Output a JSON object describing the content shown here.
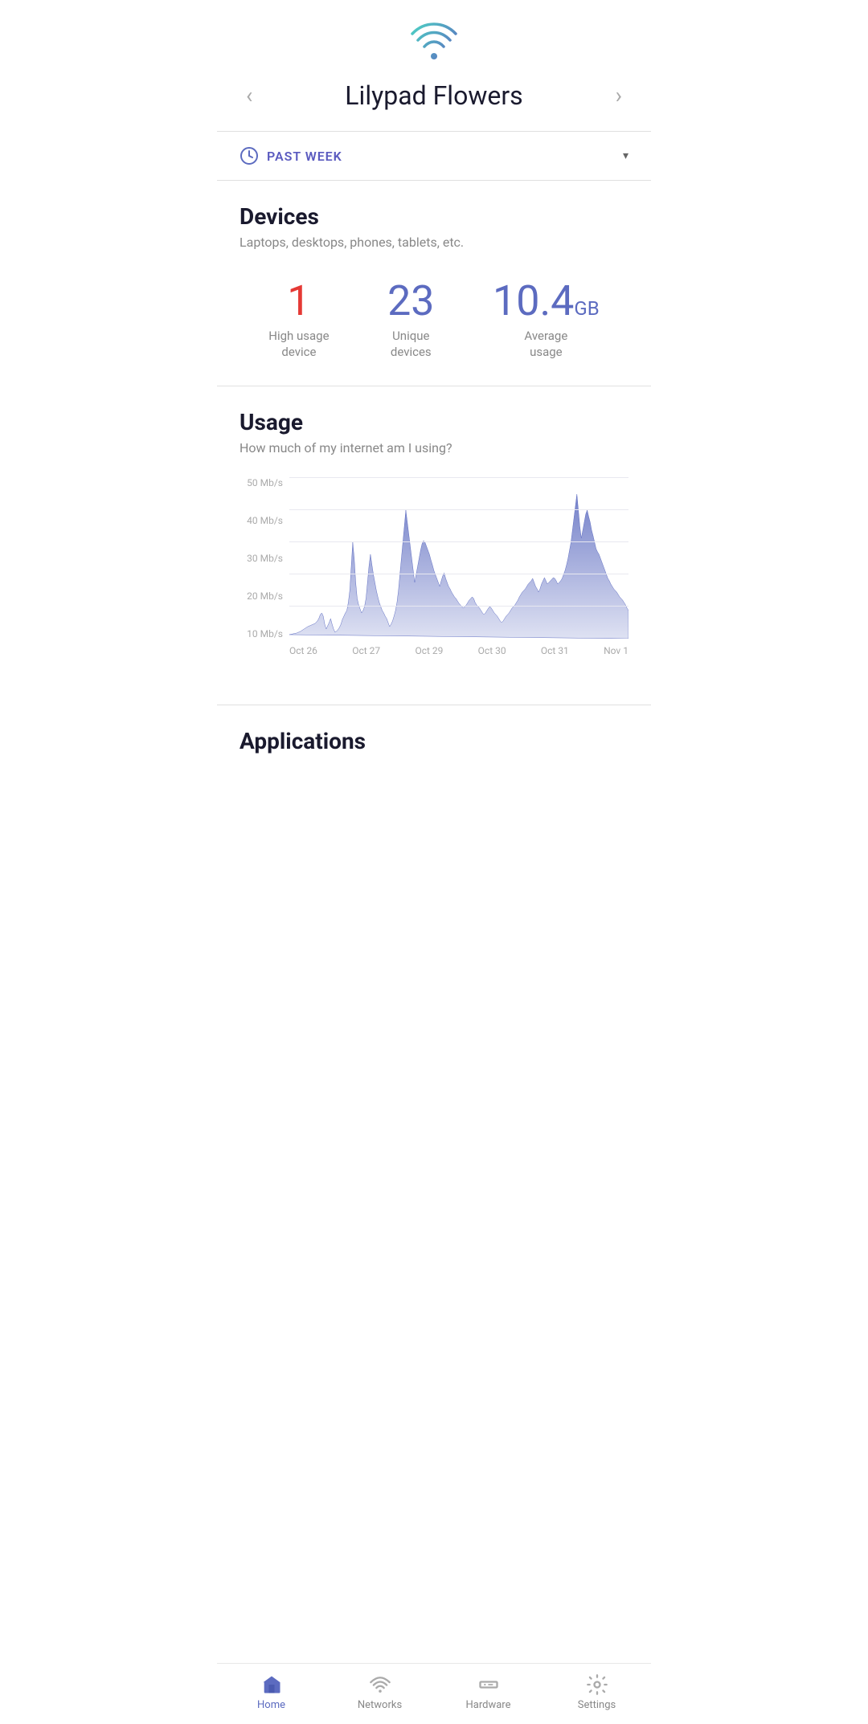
{
  "header": {
    "title": "Lilypad Flowers",
    "prev_label": "‹",
    "next_label": "›"
  },
  "time_filter": {
    "label": "PAST WEEK",
    "icon": "🕐"
  },
  "devices_section": {
    "title": "Devices",
    "subtitle": "Laptops, desktops, phones, tablets, etc.",
    "stats": [
      {
        "value": "1",
        "label": "High usage\ndevice",
        "color": "red"
      },
      {
        "value": "23",
        "label": "Unique\ndevices",
        "color": "purple"
      },
      {
        "value": "10.4",
        "suffix": "GB",
        "label": "Average\nusage",
        "color": "purple-gb"
      }
    ]
  },
  "usage_section": {
    "title": "Usage",
    "subtitle": "How much of my internet am I using?",
    "y_labels": [
      "10 Mb/s",
      "20 Mb/s",
      "30 Mb/s",
      "40 Mb/s",
      "50 Mb/s"
    ],
    "x_labels": [
      "Oct 26",
      "Oct 27",
      "Oct 29",
      "Oct 30",
      "Oct 31",
      "Nov 1"
    ]
  },
  "applications_section": {
    "title": "Applications"
  },
  "bottom_nav": {
    "items": [
      {
        "id": "home",
        "label": "Home",
        "active": true
      },
      {
        "id": "networks",
        "label": "Networks",
        "active": false
      },
      {
        "id": "hardware",
        "label": "Hardware",
        "active": false
      },
      {
        "id": "settings",
        "label": "Settings",
        "active": false
      }
    ]
  }
}
